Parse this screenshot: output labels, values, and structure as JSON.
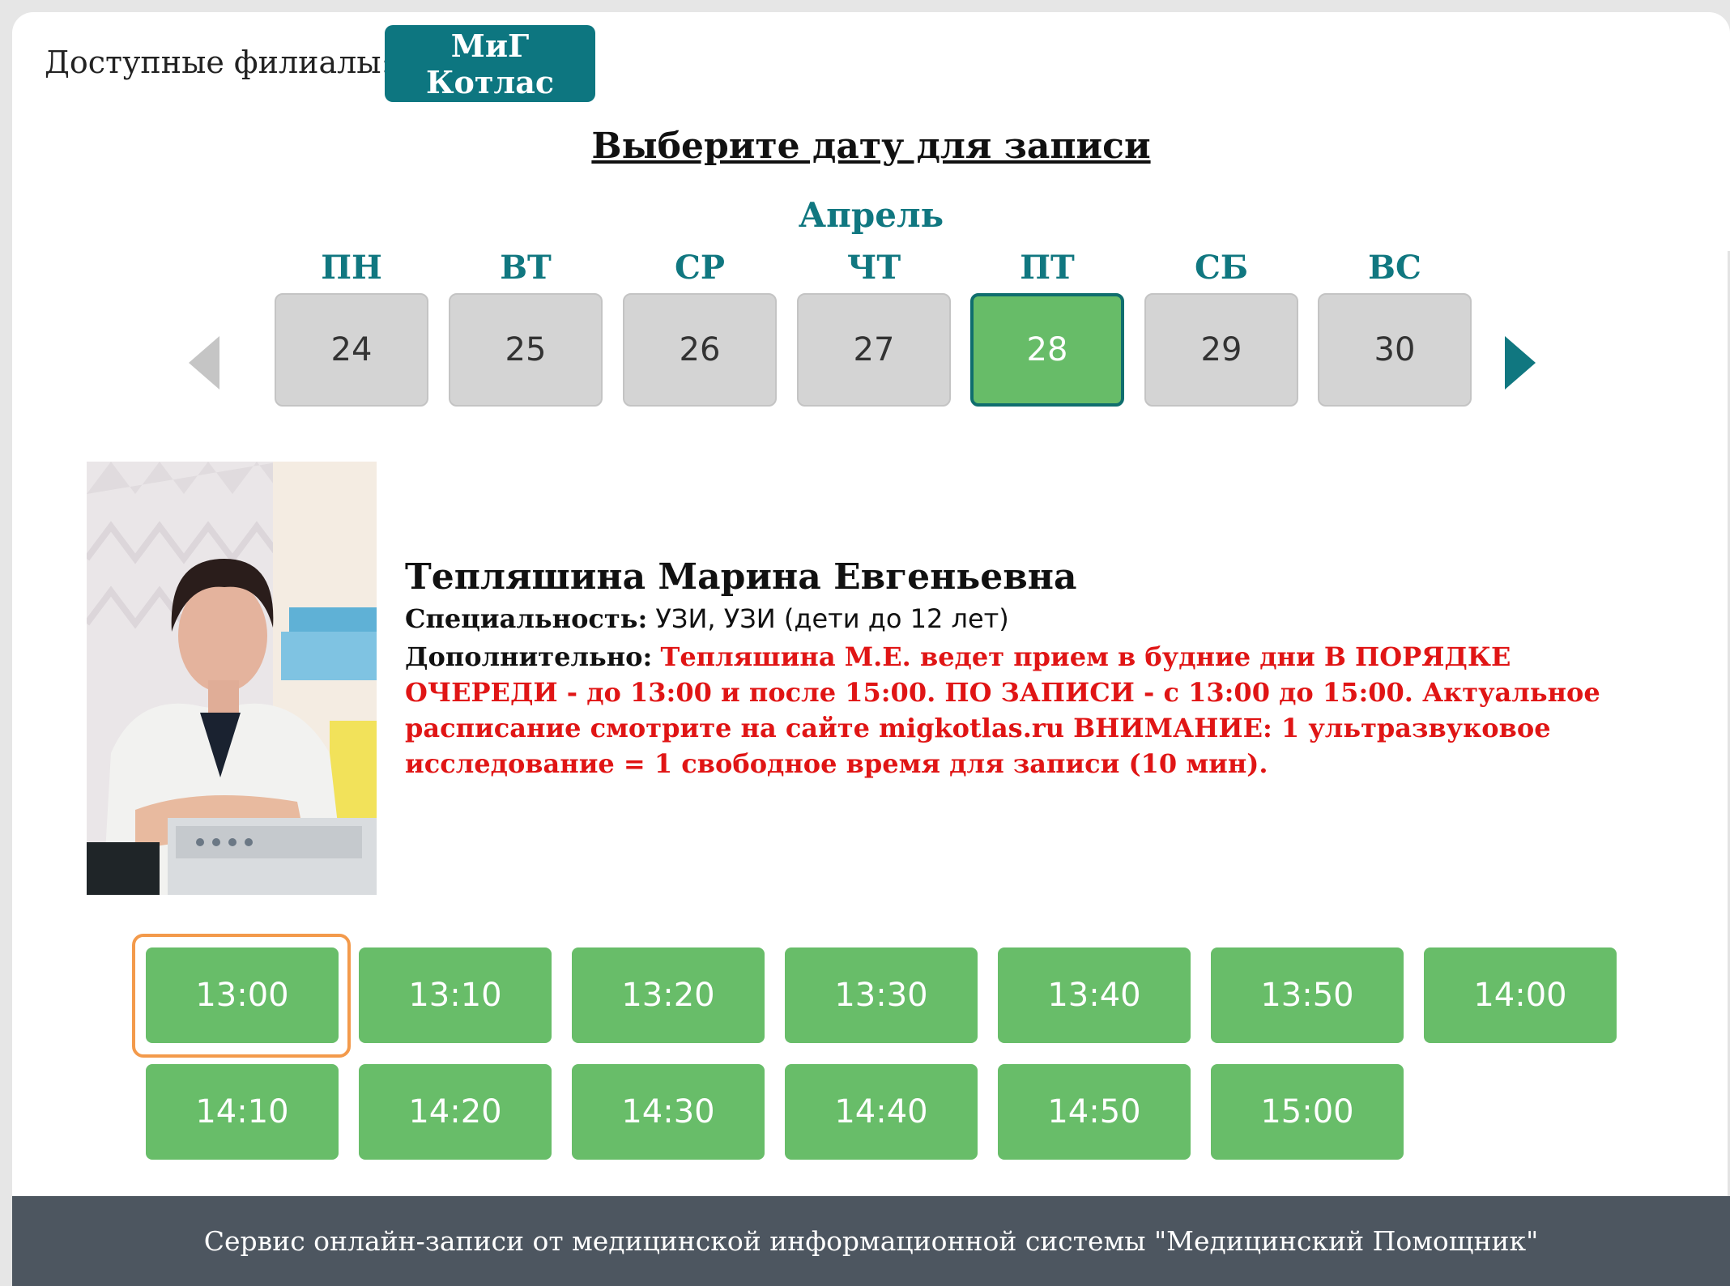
{
  "branches": {
    "label": "Доступные филиалы:",
    "items": [
      "МиГ Котлас"
    ]
  },
  "calendar": {
    "title": "Выберите дату для записи",
    "month": "Апрель",
    "days_of_week": [
      "ПН",
      "ВТ",
      "СР",
      "ЧТ",
      "ПТ",
      "СБ",
      "ВС"
    ],
    "dates": [
      "24",
      "25",
      "26",
      "27",
      "28",
      "29",
      "30"
    ],
    "selected_date": "28",
    "prev_icon": "triangle-left-icon",
    "next_icon": "triangle-right-icon"
  },
  "doctor": {
    "name": "Тепляшина Марина Евгеньевна",
    "specialty_label": "Специальность:",
    "specialty_value": "УЗИ, УЗИ (дети до 12 лет)",
    "extra_label": "Дополнительно:",
    "extra_value": "Тепляшина М.Е. ведет прием в будние дни В ПОРЯДКЕ ОЧЕРЕДИ - до 13:00 и после 15:00. ПО ЗАПИСИ - с 13:00 до 15:00. Актуальное расписание смотрите на сайте migkotlas.ru ВНИМАНИЕ: 1 ультразвуковое исследование = 1 свободное время для записи (10 мин)."
  },
  "time_slots": [
    "13:00",
    "13:10",
    "13:20",
    "13:30",
    "13:40",
    "13:50",
    "14:00",
    "14:10",
    "14:20",
    "14:30",
    "14:40",
    "14:50",
    "15:00"
  ],
  "focused_slot": "13:00",
  "footer": {
    "text": "Сервис онлайн-записи от медицинской информационной системы \"Медицинский Помощник\""
  },
  "colors": {
    "accent_teal": "#0d7680",
    "slot_green": "#68bd69",
    "day_gray": "#d4d4d4",
    "alert_red": "#e01515",
    "focus_orange": "#f39a4b",
    "footer_bg": "#4d5660"
  }
}
